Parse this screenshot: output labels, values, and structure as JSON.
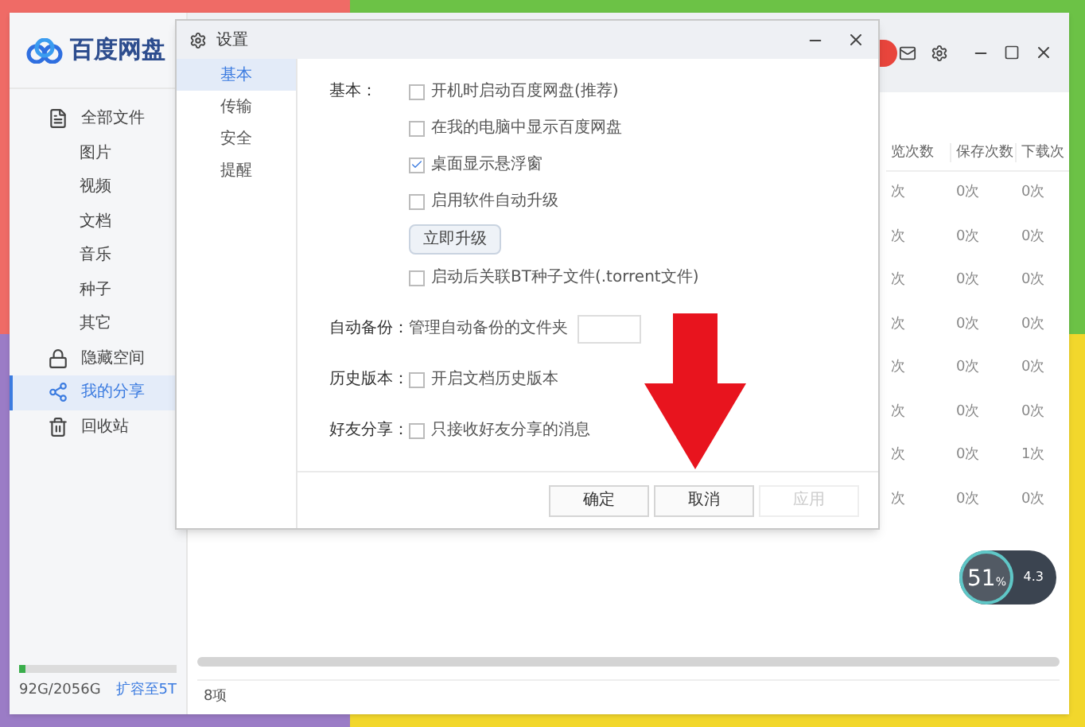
{
  "app": {
    "logo": "百度网盘"
  },
  "sidebar": {
    "items": [
      {
        "label": "全部文件",
        "kind": "files",
        "selected": false,
        "children": [
          {
            "label": "图片",
            "selected": false
          },
          {
            "label": "视频",
            "selected": false
          },
          {
            "label": "文档",
            "selected": false
          },
          {
            "label": "音乐",
            "selected": false
          },
          {
            "label": "种子",
            "selected": false
          },
          {
            "label": "其它",
            "selected": false
          }
        ]
      },
      {
        "label": "隐藏空间",
        "kind": "lock",
        "selected": false
      },
      {
        "label": "我的分享",
        "kind": "share",
        "selected": true
      },
      {
        "label": "回收站",
        "kind": "trash",
        "selected": false
      }
    ],
    "storage": {
      "usage": "92G/2056G",
      "level": 0.045,
      "upgrade_link": "扩容至5T"
    }
  },
  "table": {
    "columns": [
      "览次数",
      "保存次数",
      "下载次"
    ],
    "rows": [
      [
        "次",
        "0次",
        "0次"
      ],
      [
        "次",
        "0次",
        "0次"
      ],
      [
        "次",
        "0次",
        "0次"
      ],
      [
        "次",
        "0次",
        "0次"
      ],
      [
        "次",
        "0次",
        "0次"
      ],
      [
        "次",
        "0次",
        "0次"
      ],
      [
        "次",
        "0次",
        "1次"
      ],
      [
        "次",
        "0次",
        "0次"
      ]
    ]
  },
  "status_bar": "8项",
  "speed_widget": {
    "percent": "51",
    "unit": "%",
    "speed": "4.3"
  },
  "dialog": {
    "title": "设置",
    "nav": [
      {
        "label": "基本",
        "selected": true
      },
      {
        "label": "传输",
        "selected": false
      },
      {
        "label": "安全",
        "selected": false
      },
      {
        "label": "提醒",
        "selected": false
      }
    ],
    "sections": [
      {
        "label": "基本：",
        "items": [
          {
            "kind": "checkbox",
            "label": "开机时启动百度网盘(推荐)",
            "checked": false
          },
          {
            "kind": "checkbox",
            "label": "在我的电脑中显示百度网盘",
            "checked": false
          },
          {
            "kind": "checkbox",
            "label": "桌面显示悬浮窗",
            "checked": true
          },
          {
            "kind": "checkbox",
            "label": "启用软件自动升级",
            "checked": false
          },
          {
            "kind": "button",
            "label": "立即升级"
          },
          {
            "kind": "checkbox",
            "label": "启动后关联BT种子文件(.torrent文件)",
            "checked": false
          }
        ]
      },
      {
        "label": "自动备份：",
        "items": [
          {
            "kind": "text",
            "label": "管理自动备份的文件夹"
          }
        ]
      },
      {
        "label": "历史版本：",
        "items": [
          {
            "kind": "checkbox",
            "label": "开启文档历史版本",
            "checked": false
          }
        ]
      },
      {
        "label": "好友分享：",
        "items": [
          {
            "kind": "checkbox",
            "label": "只接收好友分享的消息",
            "checked": false
          }
        ]
      }
    ],
    "buttons": [
      {
        "label": "确定",
        "disabled": false
      },
      {
        "label": "取消",
        "disabled": false
      },
      {
        "label": "应用",
        "disabled": true
      }
    ]
  }
}
